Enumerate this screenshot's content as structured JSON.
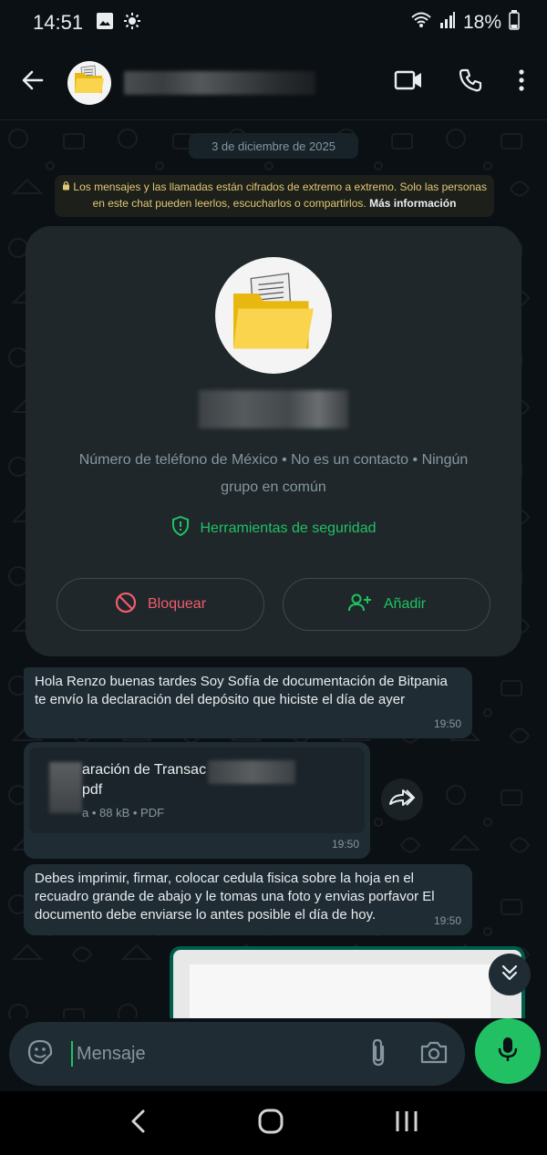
{
  "status_bar": {
    "time": "14:51",
    "battery": "18%"
  },
  "header": {
    "back_icon": "arrow-left-icon",
    "video_icon": "video-call-icon",
    "call_icon": "phone-icon",
    "menu_icon": "more-vert-icon"
  },
  "chat": {
    "date": "3 de diciembre de 2025",
    "encryption_notice": "Los mensajes y las llamadas están cifrados de extremo a extremo. Solo las personas en este chat pueden leerlos, escucharlos o compartirlos.",
    "encryption_more": "Más información",
    "contact_card": {
      "info": "Número de teléfono de México • No es un contacto • Ningún grupo en común",
      "security_label": "Herramientas de seguridad",
      "block_label": "Bloquear",
      "add_label": "Añadir"
    },
    "messages": [
      {
        "text": "Hola Renzo buenas tardes Soy Sofía de documentación de Bitpania te envío la declaración del depósito que hiciste el día de ayer",
        "time": "19:50"
      },
      {
        "doc_name_line1": "aración de Transac",
        "doc_name_line2": "pdf",
        "doc_meta": "a • 88 kB • PDF",
        "time": "19:50"
      },
      {
        "text": "Debes imprimir, firmar, colocar cedula fisica sobre la hoja en el recuadro grande de abajo y le tomas una foto y   envias porfavor El documento debe enviarse lo antes posible el día de hoy.",
        "time": "19:50"
      }
    ]
  },
  "composer": {
    "placeholder": "Mensaje"
  },
  "colors": {
    "accent": "#21c063",
    "danger": "#f15c6d",
    "bubble": "#1f2c34",
    "background": "#0b1014"
  }
}
